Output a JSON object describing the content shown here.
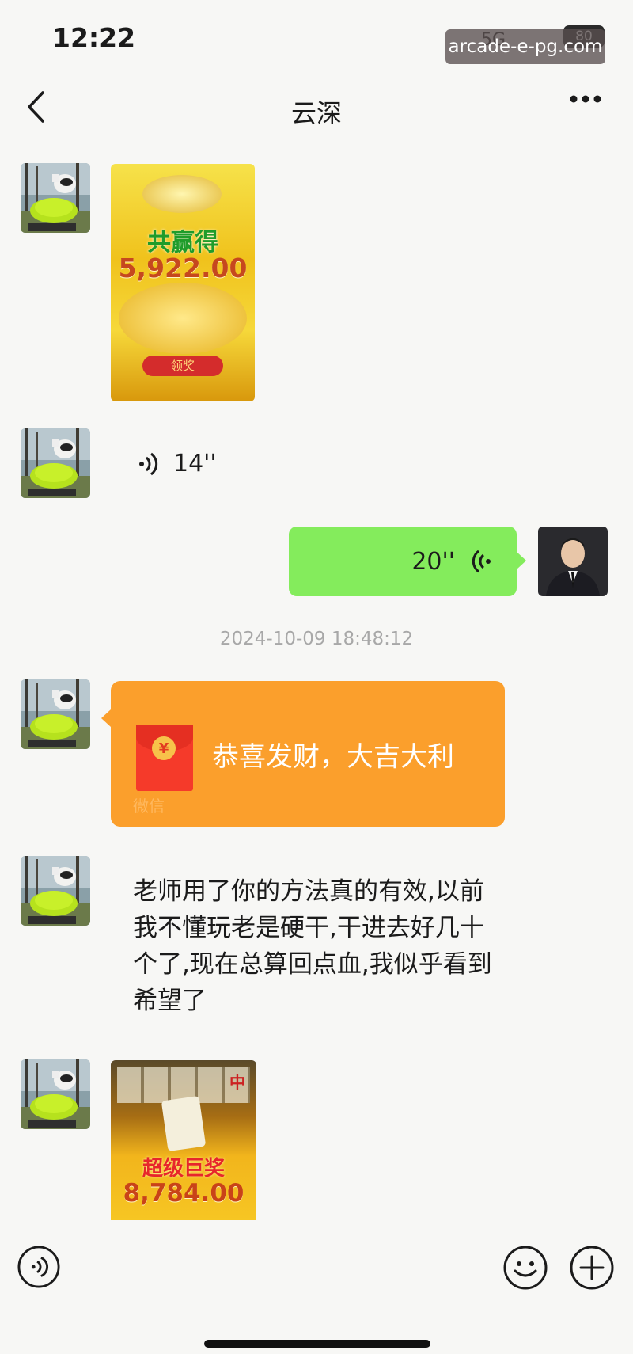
{
  "status_bar": {
    "time": "12:22",
    "watermark": "arcade-e-pg.com",
    "network": "5G",
    "battery": "80"
  },
  "header": {
    "back_icon": "chevron-left-icon",
    "title": "云深",
    "more_icon": "more-dots-icon"
  },
  "messages": {
    "image1": {
      "headline": "共赢得",
      "amount": "5,922.00",
      "button": "领奖"
    },
    "voice_in": {
      "duration": "14''"
    },
    "voice_out": {
      "duration": "20''"
    },
    "timestamp": "2024-10-09 18:48:12",
    "red_packet": {
      "greeting": "恭喜发财，大吉大利",
      "footer": "微信",
      "coin": "¥"
    },
    "text_message": "老师用了你的方法真的有效,以前我不懂玩老是硬干,干进去好几十个了,现在总算回点血,我似乎看到希望了",
    "image2": {
      "tile": "中",
      "headline": "超级巨奖",
      "amount": "8,784.00"
    }
  },
  "bottom_bar": {
    "voice_icon": "voice-input-icon",
    "emoji_icon": "emoji-icon",
    "plus_icon": "plus-icon"
  },
  "colors": {
    "background": "#f7f7f5",
    "bubble_self": "#84ec5c",
    "red_packet": "#fb9f2c"
  }
}
